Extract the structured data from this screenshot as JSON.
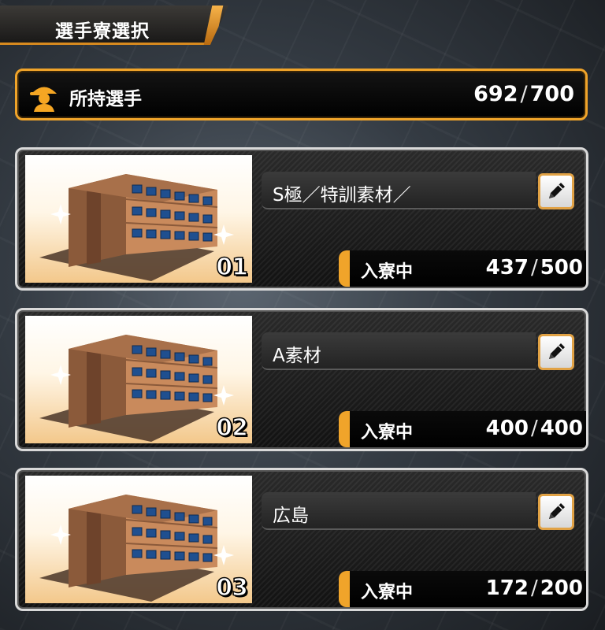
{
  "header": {
    "title": "選手寮選択"
  },
  "owned": {
    "label": "所持選手",
    "current": "692",
    "max": "700",
    "icon": "player-cap-icon"
  },
  "dorms": [
    {
      "number": "01",
      "name": "S極／特訓素材／",
      "status_label": "入寮中",
      "current": "437",
      "max": "500"
    },
    {
      "number": "02",
      "name": "A素材",
      "status_label": "入寮中",
      "current": "400",
      "max": "400"
    },
    {
      "number": "03",
      "name": "広島",
      "status_label": "入寮中",
      "current": "172",
      "max": "200"
    }
  ],
  "colors": {
    "accent": "#f0a42a",
    "card_border": "#d9d9d9"
  },
  "icons": {
    "edit": "pencil-icon",
    "dorm": "dorm-building-icon"
  }
}
